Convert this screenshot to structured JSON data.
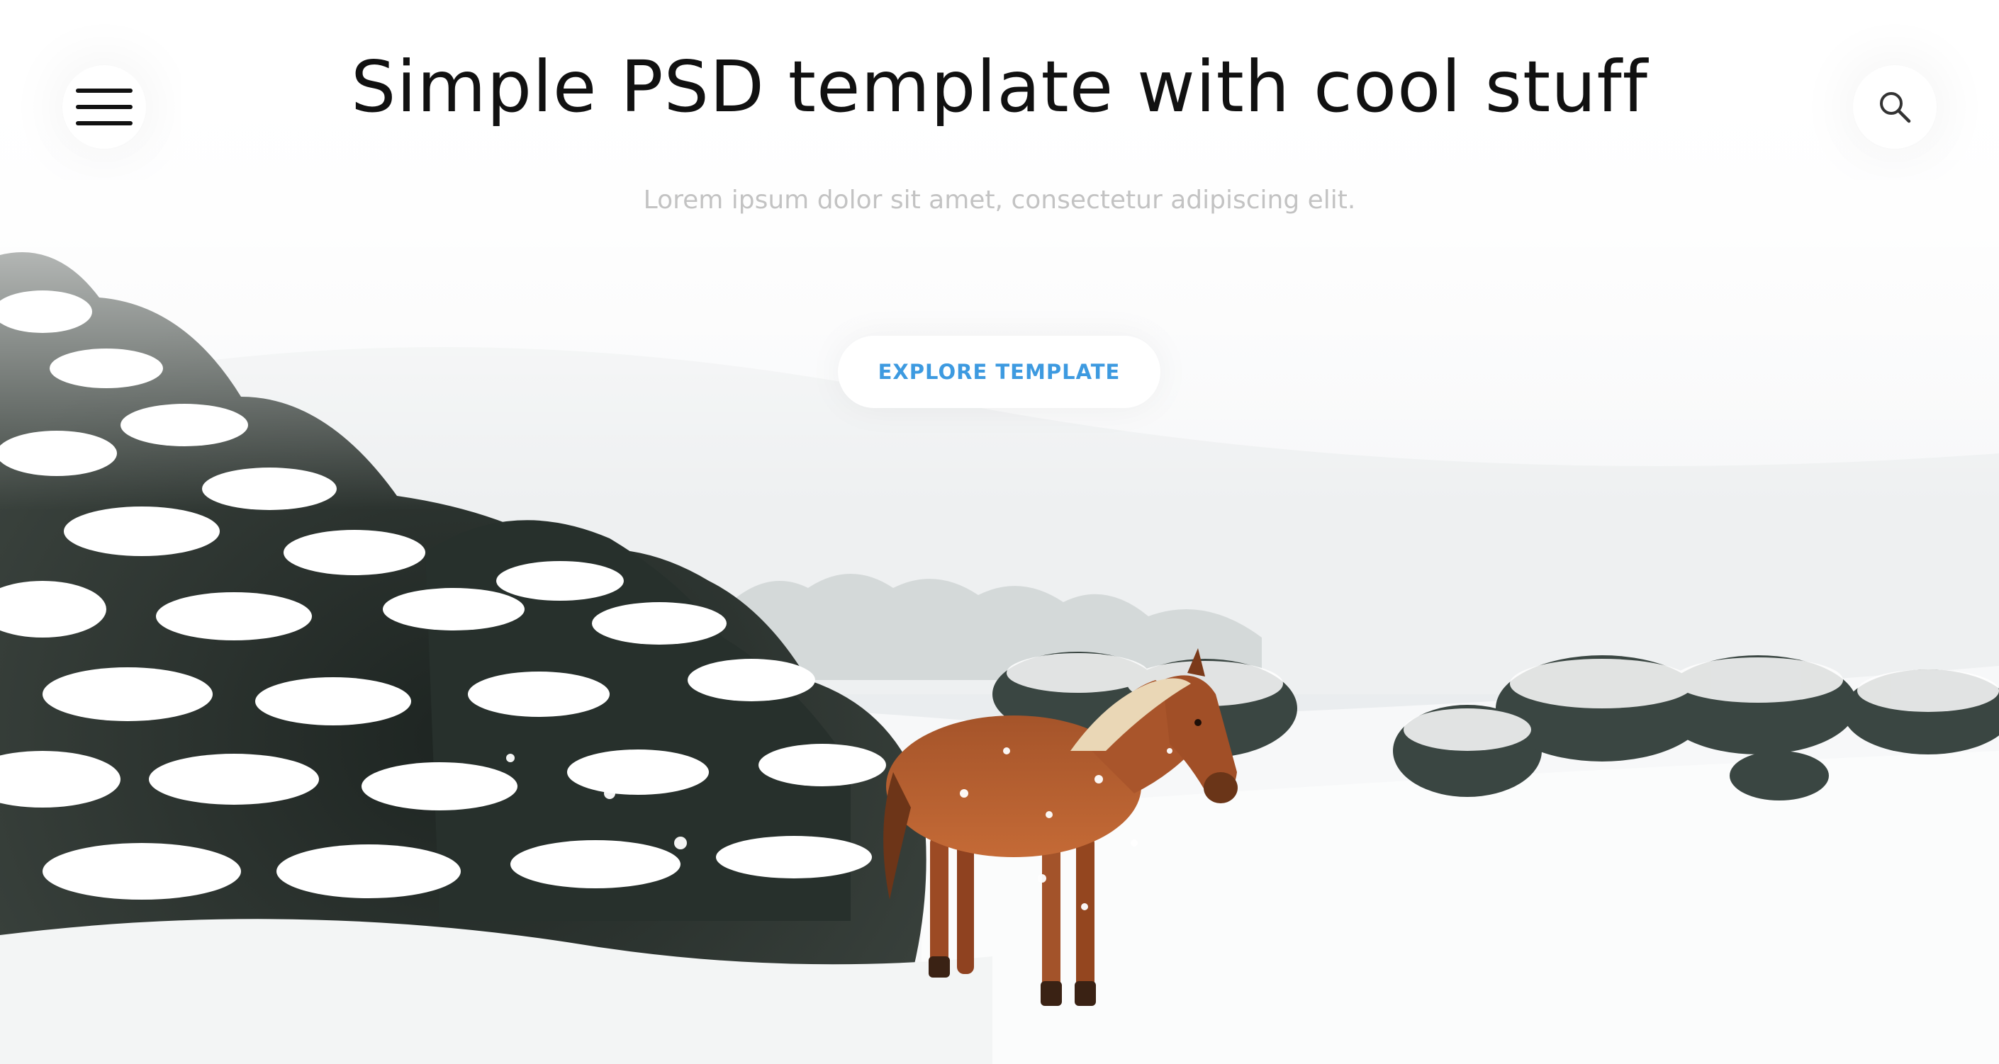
{
  "header": {
    "menu_icon": "hamburger-menu-icon",
    "search_icon": "search-icon"
  },
  "hero": {
    "title": "Simple PSD template with cool stuff",
    "subtitle": "Lorem ipsum dolor sit amet, consectetur adipiscing elit.",
    "cta_label": "EXPLORE TEMPLATE",
    "background": "snowy-landscape-with-horse"
  },
  "colors": {
    "accent": "#3d9ae0",
    "title": "#111111",
    "subtitle": "#c3c3c3",
    "horse": "#b85a2a"
  }
}
